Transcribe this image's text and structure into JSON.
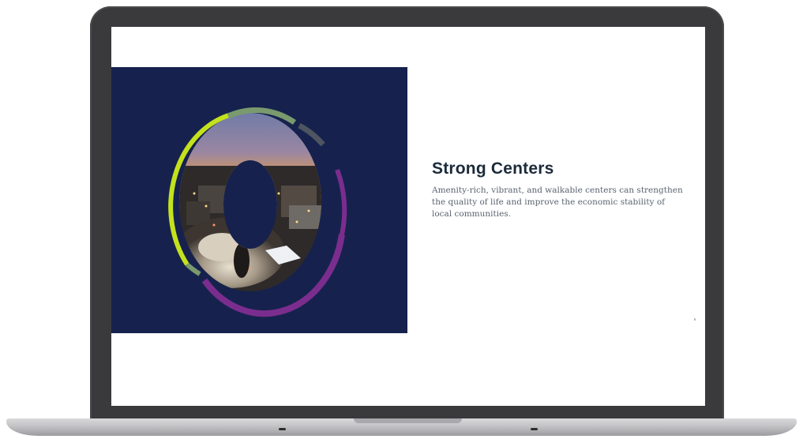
{
  "slide": {
    "heading": "Strong Centers",
    "body": "Amenity-rich, vibrant, and walkable centers can strengthen the quality of life and improve the economic stability of local communities."
  },
  "colors": {
    "panel_bg": "#16224d",
    "ring_lime": "#c4e21c",
    "ring_sage": "#7a9a6e",
    "ring_purple": "#7b2d8e",
    "ring_grey": "#4f5560",
    "heading": "#1c2a3a",
    "body_text": "#5a6470"
  },
  "image": {
    "subject": "aerial-city-festival-at-sunset"
  }
}
